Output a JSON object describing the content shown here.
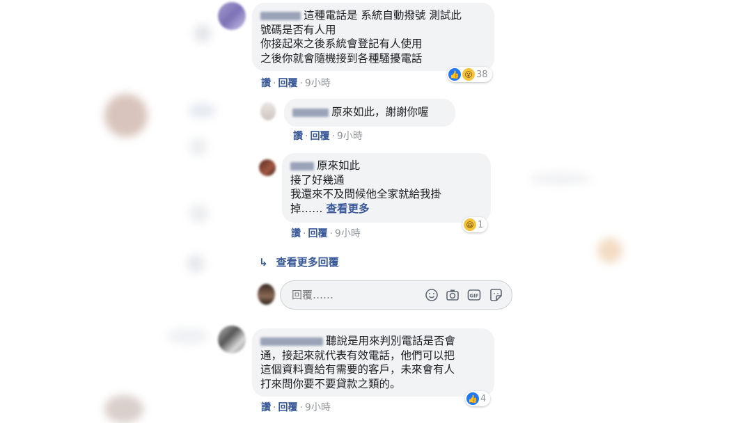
{
  "comment1": {
    "lines": [
      "這種電話是 系統自動撥號 測試此",
      "號碼是否有人用",
      "你接起來之後系統會登記有人使用",
      "之後你就會隨機接到各種騷擾電話"
    ],
    "like_label": "讚",
    "reply_label": "回覆",
    "time": "9小時",
    "reaction_count": "38"
  },
  "reply1": {
    "text": "原來如此，謝謝你喔",
    "like_label": "讚",
    "reply_label": "回覆",
    "time": "9小時"
  },
  "reply2": {
    "lines": [
      "原來如此",
      "接了好幾通",
      "我還來不及問候他全家就給我掛"
    ],
    "last_line": "掉……",
    "see_more": "查看更多",
    "like_label": "讚",
    "reply_label": "回覆",
    "time": "9小時",
    "reaction_count": "1"
  },
  "more_replies": "查看更多回覆",
  "reply_input": {
    "placeholder": "回覆……"
  },
  "reply_tools": [
    "emoji-icon",
    "camera-icon",
    "gif-icon",
    "sticker-icon"
  ],
  "comment2": {
    "lines": [
      "聽說是用來判別電話是否會",
      "通，接起來就代表有效電話，他們可以把",
      "這個資料賣給有需要的客戶，未來會有人",
      "打來問你要不要貸款之類的。"
    ],
    "like_label": "讚",
    "reply_label": "回覆",
    "time": "9小時",
    "reaction_count": "4"
  },
  "colors": {
    "link": "#385898",
    "bubble": "#f2f3f5",
    "like": "#2078f4"
  }
}
